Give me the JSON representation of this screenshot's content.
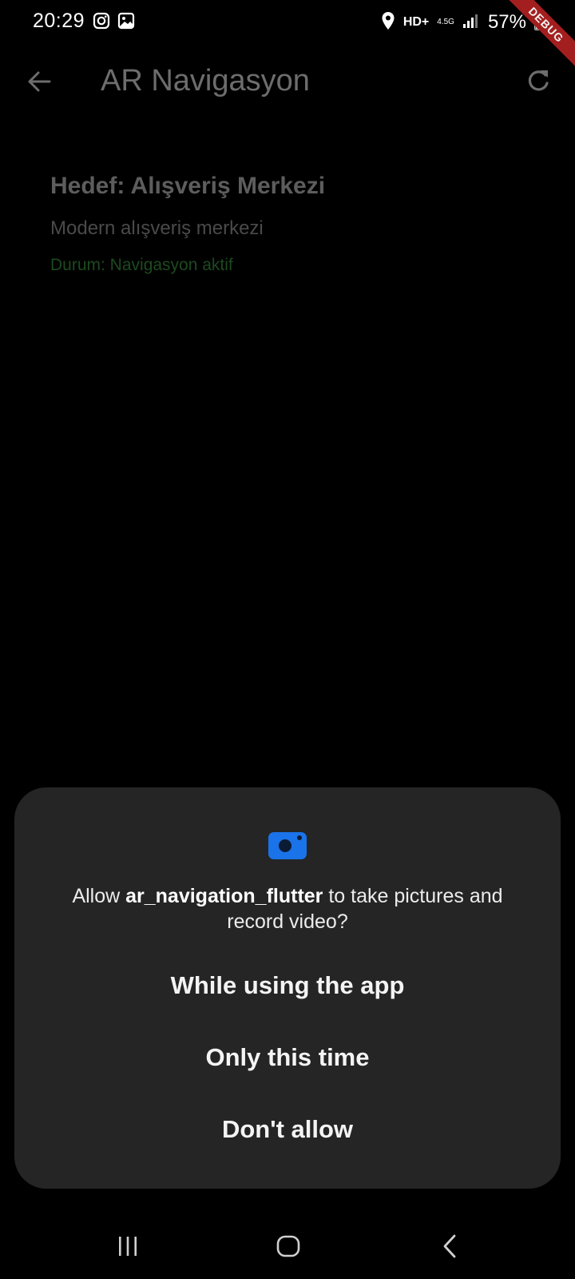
{
  "status_bar": {
    "time": "20:29",
    "left_icons": [
      "instagram-icon",
      "gallery-icon"
    ],
    "hd_label": "HD+",
    "network_label": "4.5G",
    "battery_text": "57%",
    "debug_label": "DEBUG"
  },
  "app_bar": {
    "title": "AR Navigasyon",
    "back_icon": "arrow-left-icon",
    "refresh_icon": "refresh-icon"
  },
  "destination": {
    "title": "Hedef: Alışveriş Merkezi",
    "description": "Modern alışveriş merkezi",
    "status": "Durum: Navigasyon aktif"
  },
  "permission_dialog": {
    "icon": "camera-icon",
    "message_prefix": "Allow ",
    "app_name": "ar_navigation_flutter",
    "message_suffix": " to take pictures and record video?",
    "options": [
      {
        "label": "While using the app"
      },
      {
        "label": "Only this time"
      },
      {
        "label": "Don't allow"
      }
    ]
  },
  "nav_bar": {
    "recent_icon": "recent-apps-icon",
    "home_icon": "home-icon",
    "back_icon": "back-icon"
  },
  "colors": {
    "background": "#000000",
    "dialog": "#252525",
    "accent": "#1a73e8",
    "status_green": "#1d4a1f"
  }
}
